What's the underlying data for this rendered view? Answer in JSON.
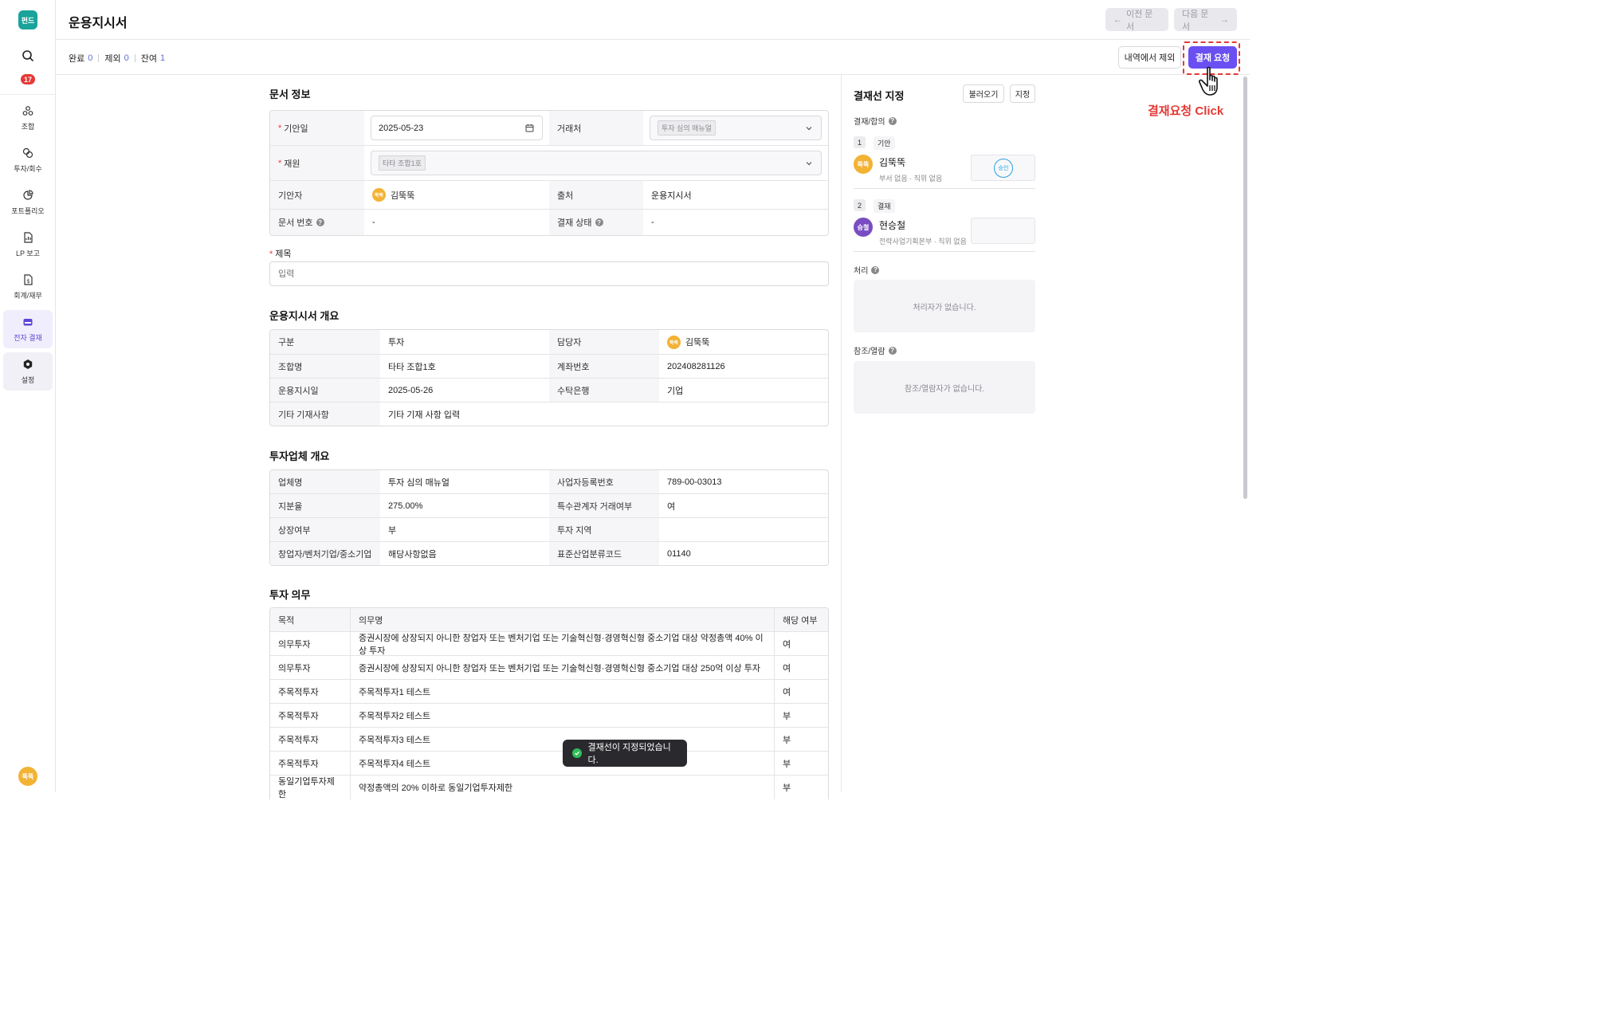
{
  "sidebar": {
    "logo": "펀드",
    "badge_count": "17",
    "items": [
      {
        "label": "조합",
        "icon": "union-icon"
      },
      {
        "label": "투자/회수",
        "icon": "investment-icon"
      },
      {
        "label": "포트폴리오",
        "icon": "portfolio-icon"
      },
      {
        "label": "LP 보고",
        "icon": "report-icon"
      },
      {
        "label": "회계/재무",
        "icon": "accounting-icon"
      },
      {
        "label": "전자 결재",
        "icon": "approval-icon"
      },
      {
        "label": "설정",
        "icon": "settings-icon"
      }
    ],
    "user_avatar": "뚝뚝"
  },
  "header": {
    "title": "운용지시서",
    "prev_label": "이전 문서",
    "next_label": "다음 문서"
  },
  "subbar": {
    "done_label": "완료",
    "done_count": "0",
    "excluded_label": "제외",
    "excluded_count": "0",
    "remaining_label": "잔여",
    "remaining_count": "1",
    "exclude_button": "내역에서 제외",
    "approve_button": "결재 요청"
  },
  "annotation": "결재요청 Click",
  "doc_info": {
    "section_title": "문서 정보",
    "date_label": "기안일",
    "date_value": "2025-05-23",
    "client_label": "거래처",
    "client_chip": "투자 심의 매뉴얼",
    "fund_label": "재원",
    "fund_chip": "타타 조합1호",
    "drafter_label": "기안자",
    "drafter_avatar": "뚝뚝",
    "drafter_name": "김뚝뚝",
    "source_label": "출처",
    "source_value": "운용지시서",
    "docno_label": "문서 번호",
    "docno_value": "-",
    "status_label": "결재 상태",
    "status_value": "-",
    "title_label": "제목",
    "title_placeholder": "입력"
  },
  "overview": {
    "section_title": "운용지시서 개요",
    "rows": [
      {
        "k1": "구분",
        "v1": "투자",
        "k2": "담당자",
        "v2": "김뚝뚝",
        "avatar": "뚝뚝"
      },
      {
        "k1": "조합명",
        "v1": "타타 조합1호",
        "k2": "계좌번호",
        "v2": "202408281126"
      },
      {
        "k1": "운용지시일",
        "v1": "2025-05-26",
        "k2": "수탁은행",
        "v2": "기업"
      }
    ],
    "etc_label": "기타 기재사항",
    "etc_value": "기타 기재 사항 입력"
  },
  "company": {
    "section_title": "투자업체 개요",
    "rows": [
      {
        "k1": "업체명",
        "v1": "투자 심의 매뉴얼",
        "k2": "사업자등록번호",
        "v2": "789-00-03013"
      },
      {
        "k1": "지분율",
        "v1": "275.00%",
        "k2": "특수관계자 거래여부",
        "v2": "여"
      },
      {
        "k1": "상장여부",
        "v1": "부",
        "k2": "투자 지역",
        "v2": ""
      },
      {
        "k1": "창업자/벤처기업/중소기업",
        "v1": "해당사항없음",
        "k2": "표준산업분류코드",
        "v2": "01140"
      }
    ]
  },
  "obligations": {
    "section_title": "투자 의무",
    "headers": [
      "목적",
      "의무명",
      "해당 여부"
    ],
    "rows": [
      [
        "의무투자",
        "증권시장에 상장되지 아니한 창업자 또는 벤처기업 또는 기술혁신형·경영혁신형 중소기업 대상 약정총액 40% 이상 투자",
        "여"
      ],
      [
        "의무투자",
        "증권시장에 상장되지 아니한 창업자 또는 벤처기업 또는 기술혁신형·경영혁신형 중소기업 대상 250억 이상 투자",
        "여"
      ],
      [
        "주목적투자",
        "주목적투자1 테스트",
        "여"
      ],
      [
        "주목적투자",
        "주목적투자2 테스트",
        "부"
      ],
      [
        "주목적투자",
        "주목적투자3 테스트",
        "부"
      ],
      [
        "주목적투자",
        "주목적투자4 테스트",
        "부"
      ],
      [
        "동일기업투자제한",
        "약정총액의 20% 이하로 동일기업투자제한",
        "부"
      ]
    ]
  },
  "approval_line": {
    "title": "결재선 지정",
    "load_button": "불러오기",
    "assign_button": "지정",
    "approve_label": "결재/합의",
    "steps": [
      {
        "num": "1",
        "type": "기안",
        "avatar": "뚝뚝",
        "name": "김뚝뚝",
        "dept": "부서 없음 · 직위 없음",
        "stamp": "승인",
        "color": "#f2b233"
      },
      {
        "num": "2",
        "type": "결재",
        "avatar": "승철",
        "name": "현승철",
        "dept": "전략사업기획본부 · 직위 없음",
        "stamp": "",
        "color": "#7a4cc2"
      }
    ],
    "process_label": "처리",
    "process_empty": "처리자가 없습니다.",
    "ref_label": "참조/열람",
    "ref_empty": "참조/열람자가 없습니다."
  },
  "toast": "결재선이 지정되었습니다."
}
